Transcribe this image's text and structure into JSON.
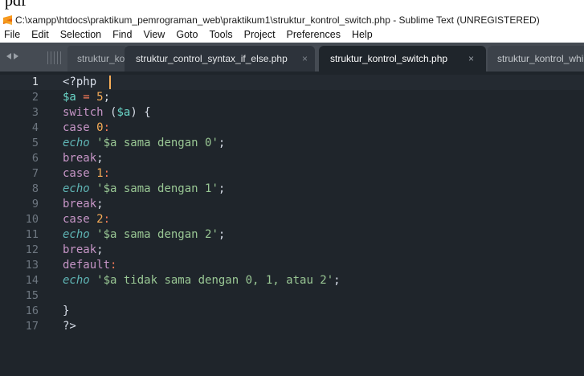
{
  "window": {
    "title": "C:\\xampp\\htdocs\\praktikum_pemrograman_web\\praktikum1\\struktur_kontrol_switch.php - Sublime Text (UNREGISTERED)"
  },
  "menu": [
    "File",
    "Edit",
    "Selection",
    "Find",
    "View",
    "Goto",
    "Tools",
    "Project",
    "Preferences",
    "Help"
  ],
  "tabs": [
    {
      "label": "struktur_kontrol_switch_alternatif.php",
      "active": false
    },
    {
      "label": "struktur_control_syntax_if_else.php",
      "active": false,
      "close": "×"
    },
    {
      "label": "struktur_kontrol_switch.php",
      "active": true,
      "close": "×"
    },
    {
      "label": "struktur_kontrol_while.php",
      "active": false
    }
  ],
  "editor": {
    "current_line": 1,
    "lines": [
      {
        "num": "1",
        "code": "<?php"
      },
      {
        "num": "2",
        "code": "$a = 5;"
      },
      {
        "num": "3",
        "code": "switch ($a) {"
      },
      {
        "num": "4",
        "code": "case 0:"
      },
      {
        "num": "5",
        "code": "echo '$a sama dengan 0';"
      },
      {
        "num": "6",
        "code": "break;"
      },
      {
        "num": "7",
        "code": "case 1:"
      },
      {
        "num": "8",
        "code": "echo '$a sama dengan 1';"
      },
      {
        "num": "9",
        "code": "break;"
      },
      {
        "num": "10",
        "code": "case 2:"
      },
      {
        "num": "11",
        "code": "echo '$a sama dengan 2';"
      },
      {
        "num": "12",
        "code": "break;"
      },
      {
        "num": "13",
        "code": "default:"
      },
      {
        "num": "14",
        "code": "echo '$a tidak sama dengan 0, 1, atau 2';"
      },
      {
        "num": "15",
        "code": ""
      },
      {
        "num": "16",
        "code": "}"
      },
      {
        "num": "17",
        "code": "?>"
      }
    ]
  },
  "colors": {
    "editor_bg": "#1f252b",
    "tabbar_bg": "#454b53",
    "keyword": "#c695c6",
    "variable": "#6ad6c8",
    "number": "#f9ae58",
    "string": "#99c794",
    "function": "#5fb4b4",
    "operator": "#f97b58"
  },
  "icons": {
    "app": "sublime-text-icon",
    "nav": [
      "arrow-left-icon",
      "arrow-right-icon"
    ],
    "tab_close": "close-icon"
  }
}
